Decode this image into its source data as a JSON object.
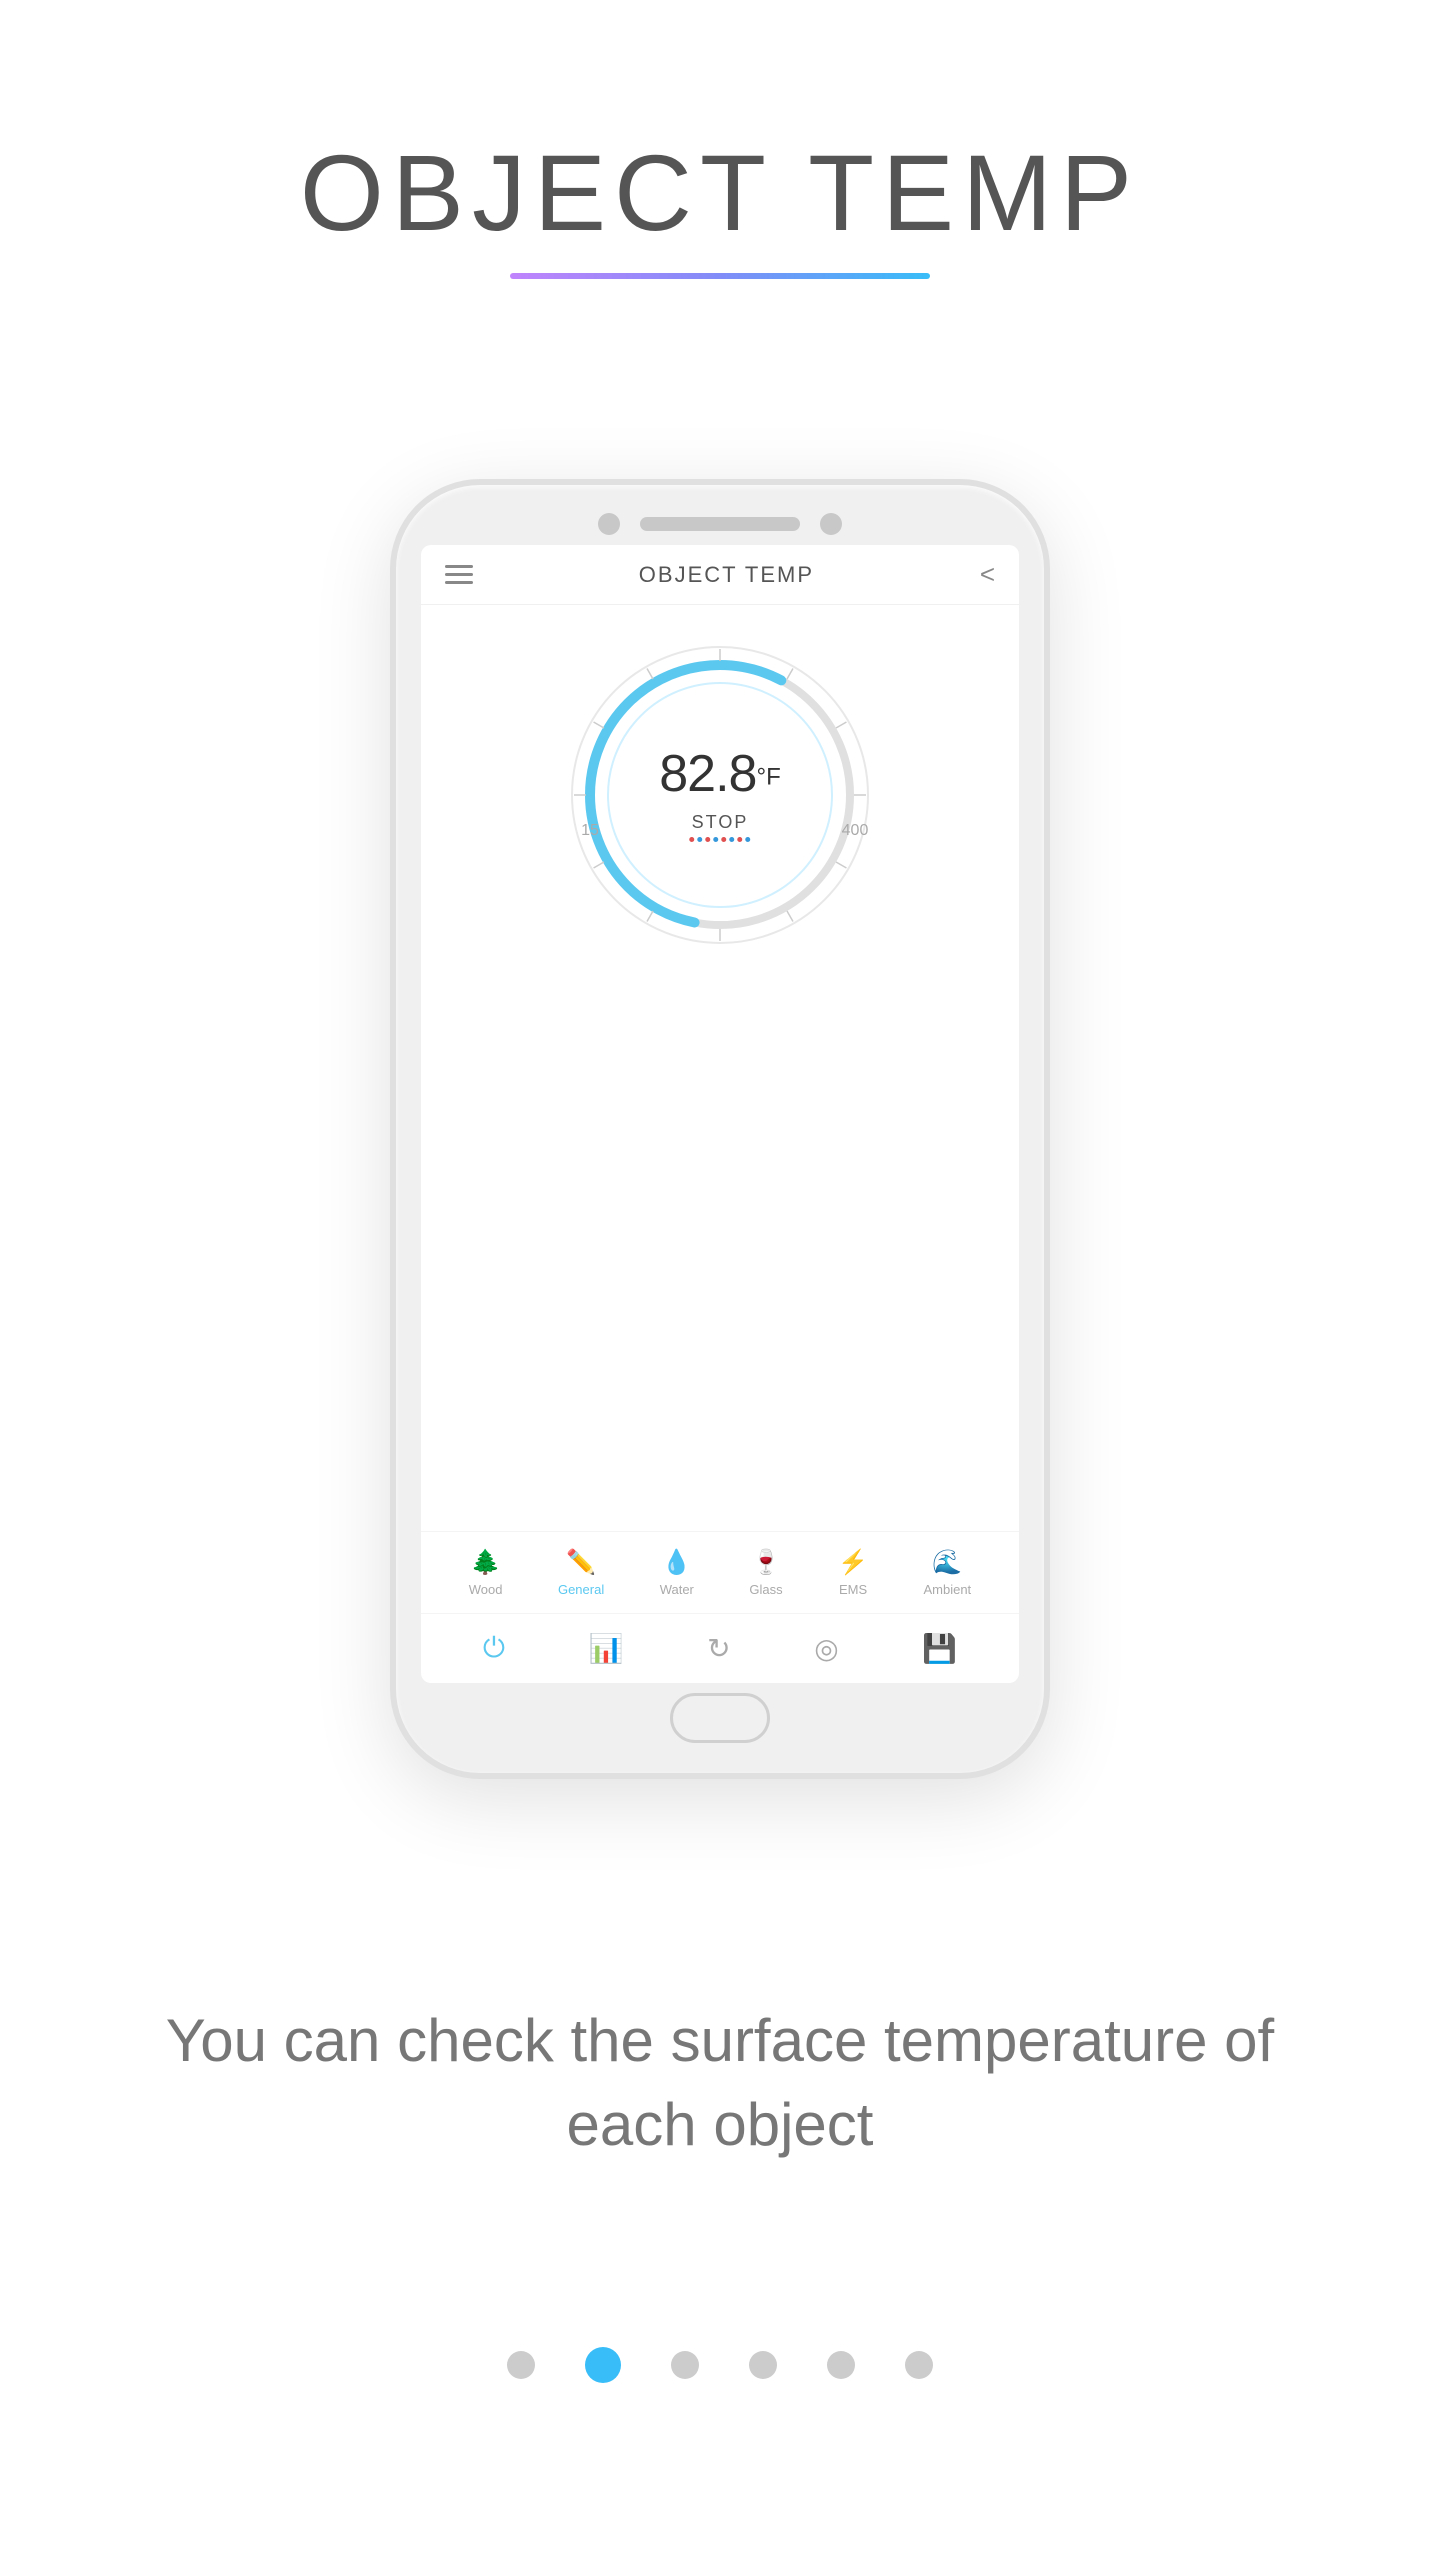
{
  "page": {
    "title": "OBJECT TEMP",
    "title_underline_gradient": "linear-gradient(to right, #c084fc, #818cf8, #38bdf8)"
  },
  "phone": {
    "screen": {
      "header_title": "OBJECT TEMP",
      "temp_value": "82.8",
      "temp_unit": "°F",
      "stop_label": "STOP",
      "object_types": [
        {
          "label": "Wood",
          "icon": "🌲",
          "active": false
        },
        {
          "label": "General",
          "icon": "✏️",
          "active": true
        },
        {
          "label": "Water",
          "icon": "💧",
          "active": false
        },
        {
          "label": "Glass",
          "icon": "🍷",
          "active": false
        },
        {
          "label": "EMS",
          "icon": "⚡",
          "active": false
        },
        {
          "label": "Ambient",
          "icon": "🌊",
          "active": false
        }
      ]
    }
  },
  "description": "You can check the surface temperature of each object",
  "pagination": {
    "total": 6,
    "active_index": 1
  }
}
